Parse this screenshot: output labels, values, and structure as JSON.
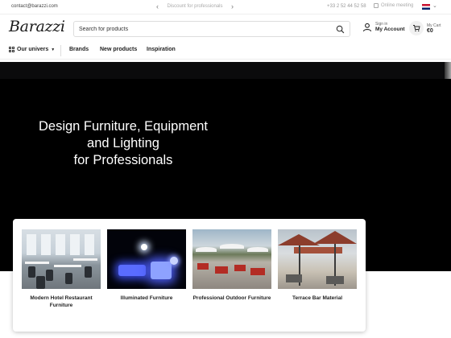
{
  "topbar": {
    "email": "contact@barazzi.com",
    "promo": "Discount for professionals",
    "phone": "+33 2 52 44 52 58",
    "meeting": "Online meeting",
    "lang": "EN"
  },
  "header": {
    "logo": "Barazzi",
    "search_placeholder": "Search for products",
    "signin_small": "Sign in",
    "signin_big": "My Account",
    "cart_small": "My Cart",
    "cart_big": "€0"
  },
  "nav": {
    "univers": "Our univers",
    "items": [
      "Brands",
      "New products",
      "Inspiration"
    ]
  },
  "hero": {
    "lines": [
      "Design Furniture, Equipment",
      "and Lighting",
      "for Professionals"
    ]
  },
  "categories": [
    {
      "name": "Modern Hotel Restaurant Furniture",
      "icon": "restaurant-photo"
    },
    {
      "name": "Illuminated Furniture",
      "icon": "illuminated-photo"
    },
    {
      "name": "Professional Outdoor Furniture",
      "icon": "outdoor-photo"
    },
    {
      "name": "Terrace Bar Material",
      "icon": "terrace-photo"
    }
  ],
  "colors": {
    "hero_bg": "#000000",
    "text": "#222222",
    "accent_red": "#b32c24"
  }
}
